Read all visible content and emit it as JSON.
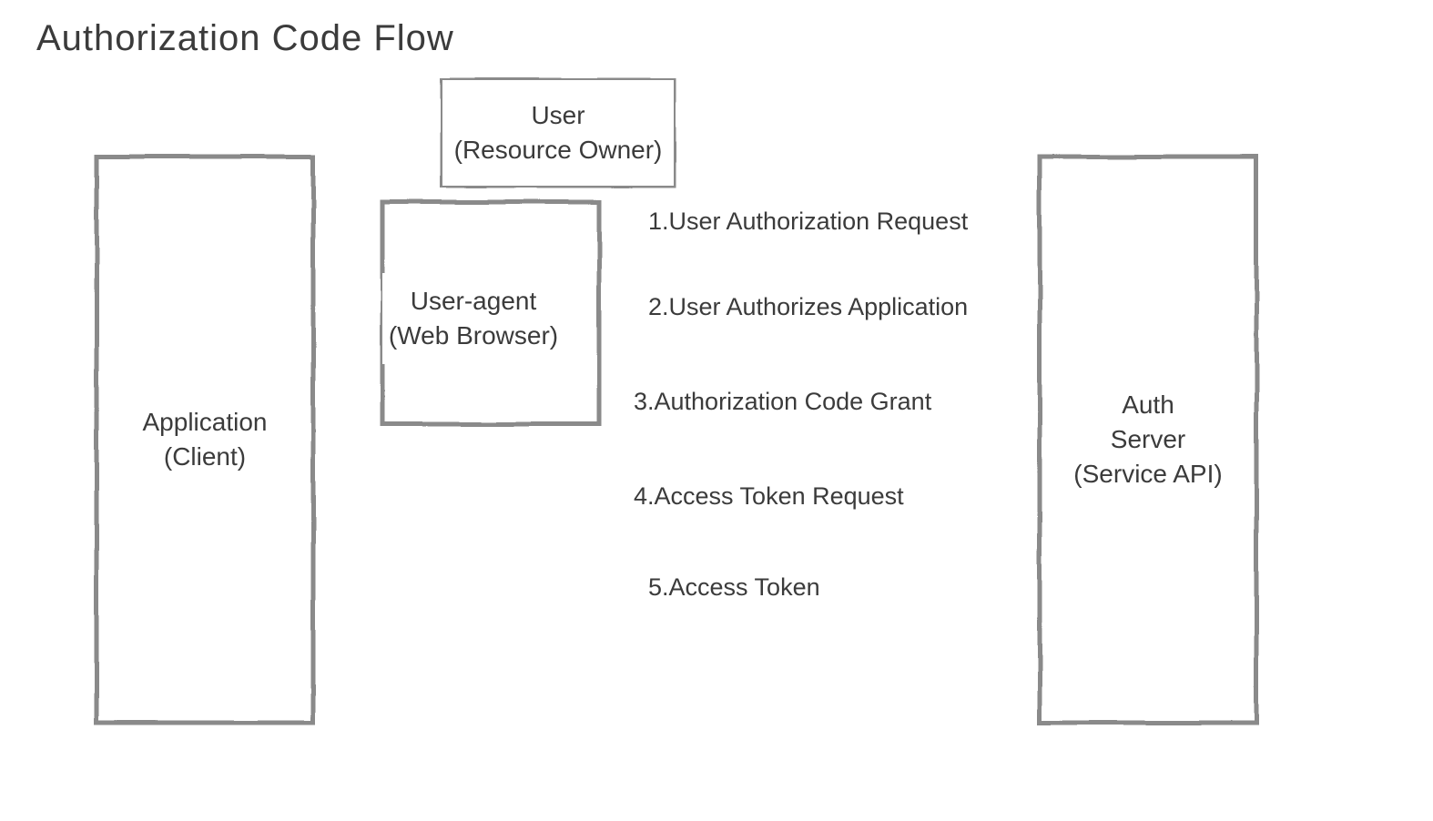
{
  "title": "Authorization Code Flow",
  "boxes": {
    "application": {
      "line1": "Application",
      "line2": "(Client)"
    },
    "user": {
      "line1": "User",
      "line2": "(Resource Owner)"
    },
    "userAgent": {
      "line1": "User-agent",
      "line2": "(Web Browser)"
    },
    "authServer": {
      "line1": "Auth",
      "line2": "Server",
      "line3": "(Service API)"
    }
  },
  "flows": {
    "f1": "1.User Authorization Request",
    "f2": "2.User Authorizes Application",
    "f3": "3.Authorization Code Grant",
    "f4": "4.Access Token Request",
    "f5": "5.Access Token"
  },
  "style": {
    "stroke": "#8a8a8a"
  }
}
